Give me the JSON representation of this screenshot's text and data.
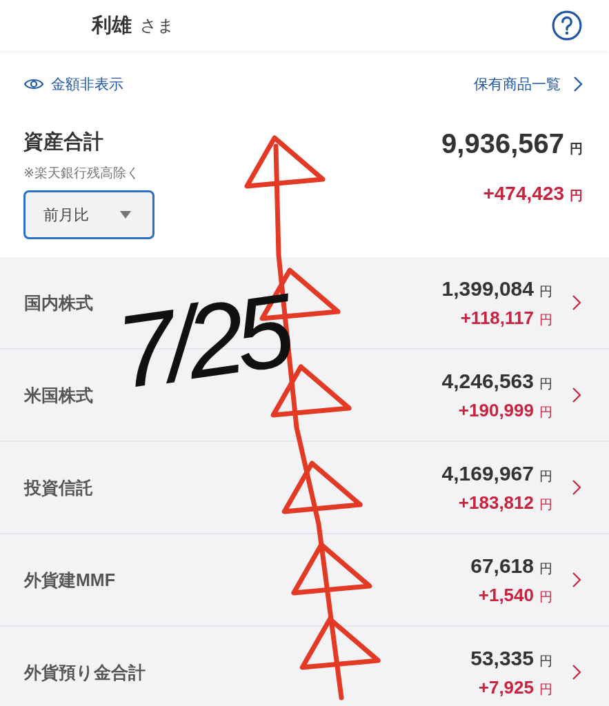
{
  "header": {
    "name": "利雄",
    "honorific": "さま"
  },
  "toolbar": {
    "hide_amounts": "金額非表示",
    "holdings_link": "保有商品一覧"
  },
  "total": {
    "label": "資産合計",
    "note": "※楽天銀行残高除く",
    "comparison": {
      "value": "前月比"
    },
    "amount": "9,936,567",
    "unit": "円",
    "change": "+474,423",
    "change_unit": "円"
  },
  "assets": [
    {
      "name": "国内株式",
      "amount": "1,399,084",
      "unit": "円",
      "change": "+118,117",
      "change_unit": "円"
    },
    {
      "name": "米国株式",
      "amount": "4,246,563",
      "unit": "円",
      "change": "+190,999",
      "change_unit": "円"
    },
    {
      "name": "投資信託",
      "amount": "4,169,967",
      "unit": "円",
      "change": "+183,812",
      "change_unit": "円"
    },
    {
      "name": "外貨建MMF",
      "amount": "67,618",
      "unit": "円",
      "change": "+1,540",
      "change_unit": "円"
    },
    {
      "name": "外貨預り金合計",
      "amount": "53,335",
      "unit": "円",
      "change": "+7,925",
      "change_unit": "円"
    }
  ],
  "annotation": {
    "text": "7/25"
  }
}
